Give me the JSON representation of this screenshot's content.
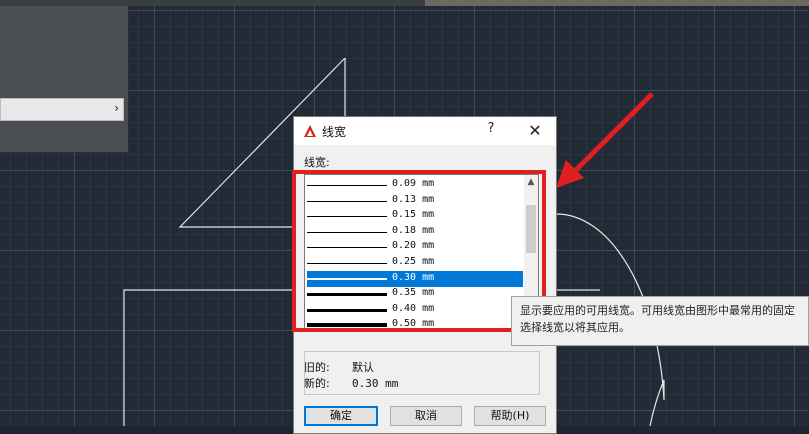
{
  "dialog": {
    "title": "线宽",
    "help_label": "?",
    "close_label": "✕",
    "list_label": "线宽:",
    "lineweights": [
      {
        "label": "0.09 mm",
        "selected": false
      },
      {
        "label": "0.13 mm",
        "selected": false
      },
      {
        "label": "0.15 mm",
        "selected": false
      },
      {
        "label": "0.18 mm",
        "selected": false
      },
      {
        "label": "0.20 mm",
        "selected": false
      },
      {
        "label": "0.25 mm",
        "selected": false
      },
      {
        "label": "0.30 mm",
        "selected": true
      },
      {
        "label": "0.35 mm",
        "selected": false
      },
      {
        "label": "0.40 mm",
        "selected": false
      },
      {
        "label": "0.50 mm",
        "selected": false
      }
    ],
    "old_label": "旧的:",
    "old_value": "默认",
    "new_label": "新的:",
    "new_value": "0.30 mm",
    "ok_label": "确定",
    "cancel_label": "取消",
    "help_button_label": "帮助(H)"
  },
  "tooltip": {
    "line1": "显示要应用的可用线宽。可用线宽由图形中最常用的固定",
    "line2": "选择线宽以将其应用。"
  },
  "left_panel": {
    "arrow": "›"
  },
  "colors": {
    "canvas_bg": "#222a36",
    "annotation": "#e02020",
    "selection": "#0078d7",
    "app_icon": "#d0271d"
  }
}
